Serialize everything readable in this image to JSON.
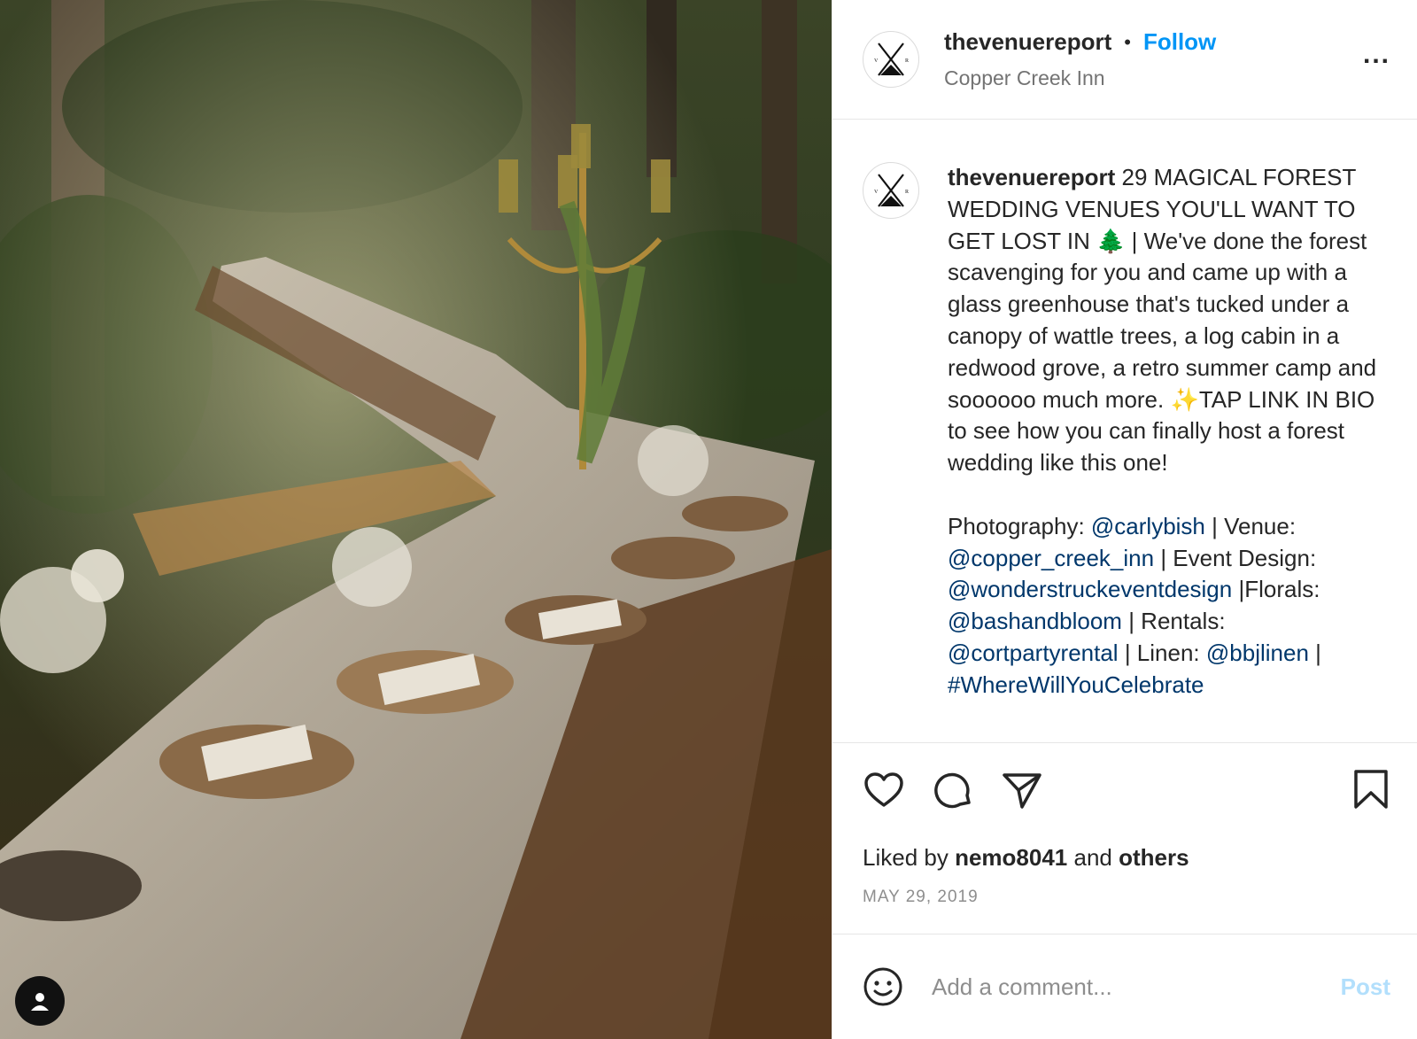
{
  "header": {
    "username": "thevenuereport",
    "separator": "•",
    "follow_label": "Follow",
    "location": "Copper Creek Inn",
    "more_label": "..."
  },
  "caption": {
    "username": "thevenuereport",
    "text_main": "29 MAGICAL FOREST WEDDING VENUES YOU'LL WANT TO GET LOST IN 🌲 | We've done the forest scavenging for you and came up with a glass greenhouse that's tucked under a canopy of wattle trees, a log cabin in a redwood grove, a retro summer camp and soooooo much more. ✨TAP LINK IN BIO to see how you can finally host a forest wedding like this one!",
    "credits": {
      "photography_label": "Photography:",
      "photography_handle": "@carlybish",
      "venue_label": "| Venue:",
      "venue_handle": "@copper_creek_inn",
      "design_label": "| Event Design:",
      "design_handle": "@wonderstruckeventdesign",
      "florals_label": "|Florals:",
      "florals_handle": "@bashandbloom",
      "rentals_label": "| Rentals:",
      "rentals_handle": "@cortpartyrental",
      "linen_label": "| Linen:",
      "linen_handle": "@bbjlinen",
      "linen_end": "|",
      "hashtag": "#WhereWillYouCelebrate"
    }
  },
  "actions": {
    "icons": [
      "heart-icon",
      "comment-icon",
      "share-icon",
      "bookmark-icon"
    ],
    "liked_prefix": "Liked by",
    "liked_user": "nemo8041",
    "liked_and": "and",
    "liked_others": "others",
    "date": "MAY 29, 2019"
  },
  "comment": {
    "placeholder": "Add a comment...",
    "post_label": "Post"
  },
  "colors": {
    "link": "#00376b",
    "follow": "#0095f6",
    "post_disabled": "#b2dffc",
    "muted": "#8e8e8e"
  }
}
